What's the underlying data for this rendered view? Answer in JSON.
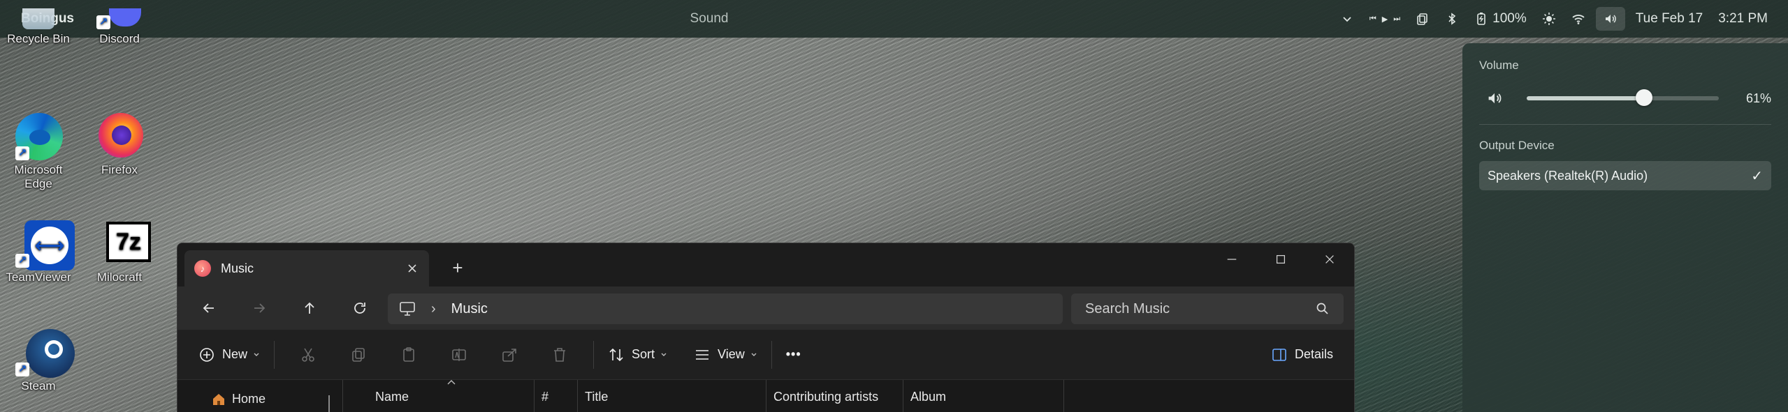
{
  "topbar": {
    "app_name": "Boingus",
    "window_title": "Sound",
    "battery": "100%",
    "date": "Tue Feb 17",
    "time": "3:21 PM"
  },
  "desktop_icons": [
    {
      "label": "Recycle Bin",
      "icon": "recycle-bin-icon"
    },
    {
      "label": "Discord",
      "icon": "discord-icon"
    },
    {
      "label": "Microsoft Edge",
      "icon": "edge-icon"
    },
    {
      "label": "Firefox",
      "icon": "firefox-icon"
    },
    {
      "label": "TeamViewer",
      "icon": "teamviewer-icon"
    },
    {
      "label": "Milocraft",
      "icon": "7zip-icon",
      "logo_text": "7z"
    },
    {
      "label": "Steam",
      "icon": "steam-icon"
    }
  ],
  "sound_panel": {
    "volume_label": "Volume",
    "volume_value": 61,
    "volume_text": "61%",
    "output_label": "Output Device",
    "device": "Speakers (Realtek(R) Audio)",
    "check": "✓"
  },
  "explorer": {
    "tab_title": "Music",
    "new_tab": "+",
    "address_segment": "Music",
    "search_placeholder": "Search Music",
    "commands": {
      "new": "New",
      "sort": "Sort",
      "view": "View",
      "more": "•••",
      "details": "Details"
    },
    "nav_pane_home": "Home",
    "columns": [
      "Name",
      "#",
      "Title",
      "Contributing artists",
      "Album"
    ]
  },
  "colors": {
    "topbar_bg": "#22302c",
    "panel_bg": "#2a3a36",
    "explorer_bg": "#202020",
    "accent_home": "#e08a3c"
  }
}
